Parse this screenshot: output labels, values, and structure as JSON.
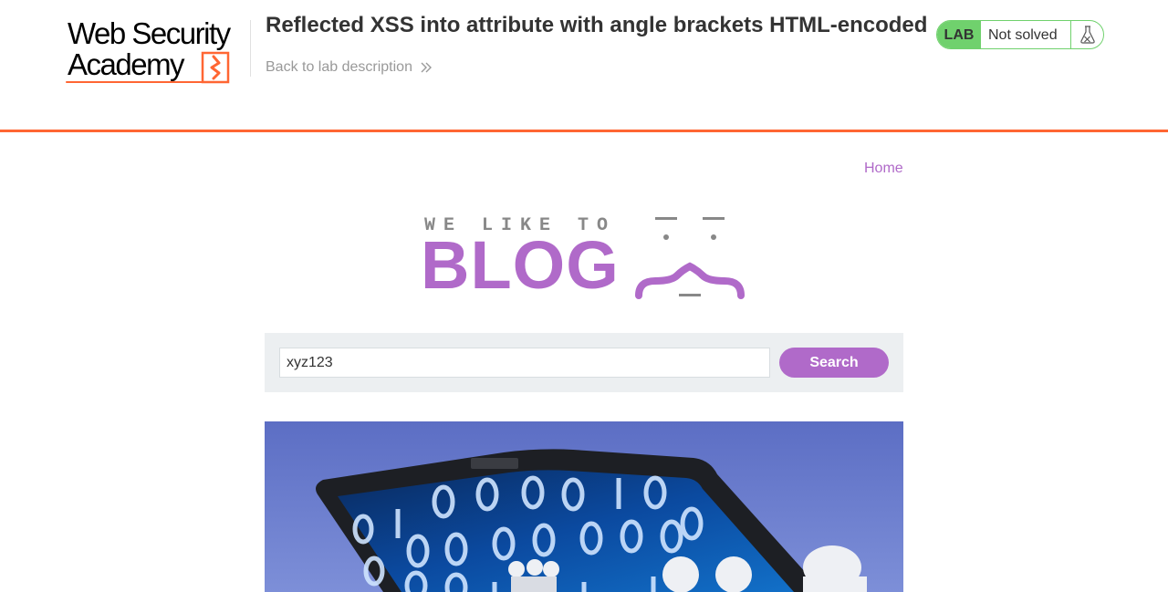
{
  "header": {
    "logo_line1": "Web Security",
    "logo_line2": "Academy",
    "lab_title": "Reflected XSS into attribute with angle brackets HTML-encoded",
    "back_link_label": "Back to lab description",
    "back_icon": "double-chevron-right-icon",
    "status": {
      "badge_label": "LAB",
      "status_label": "Not solved",
      "status_icon": "flask-icon",
      "color": "#70d16d"
    },
    "accent_color": "#ff6633"
  },
  "nav": {
    "home_label": "Home",
    "link_color": "#b06ac9"
  },
  "banner": {
    "tagline": "WE LIKE TO",
    "title": "BLOG",
    "brand_color": "#b06ac9"
  },
  "search": {
    "value": "xyz123",
    "button_label": "Search",
    "button_color": "#b06ac9"
  },
  "post": {
    "image_subject": "laptop-with-binary-code-and-figures"
  }
}
